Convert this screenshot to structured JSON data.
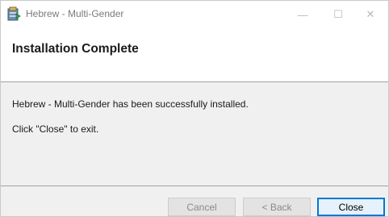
{
  "window": {
    "title": "Hebrew - Multi-Gender",
    "controls": {
      "minimize": "—",
      "maximize": "☐",
      "close": "✕"
    },
    "icon": "installer-package-icon"
  },
  "header": {
    "title": "Installation Complete"
  },
  "body": {
    "message": "Hebrew - Multi-Gender has been successfully installed.",
    "instruction": "Click \"Close\" to exit."
  },
  "footer": {
    "cancel_label": "Cancel",
    "back_label": "< Back",
    "close_label": "Close"
  },
  "colors": {
    "accent": "#0078d7",
    "panel": "#f0f0f0"
  }
}
